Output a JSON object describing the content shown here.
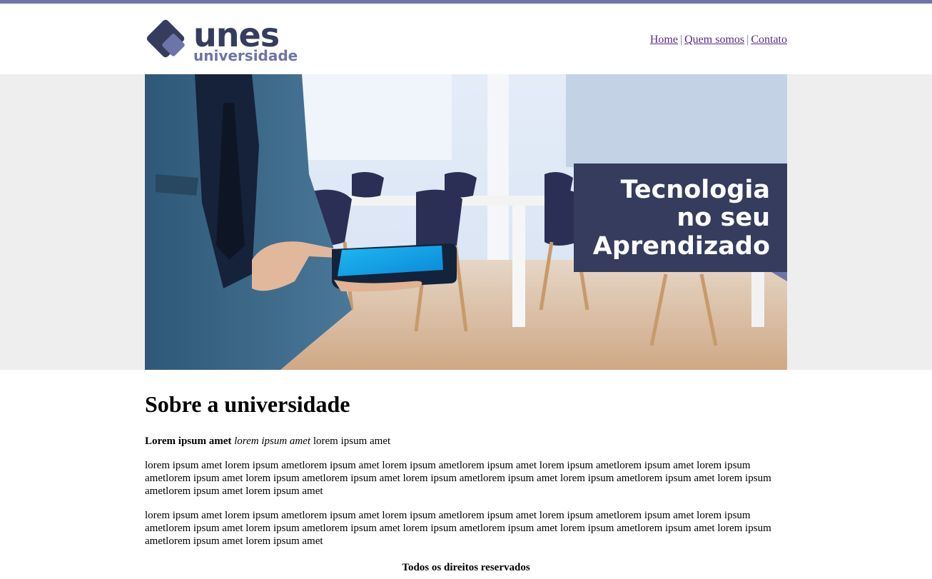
{
  "brand": {
    "name": "unes",
    "tagline": "universidade",
    "colors": {
      "primary": "#363c5e",
      "accent": "#6d75a8"
    }
  },
  "nav": {
    "items": [
      {
        "label": "Home"
      },
      {
        "label": "Quem somos"
      },
      {
        "label": "Contato"
      }
    ],
    "separator": "|"
  },
  "banner": {
    "line1": "Tecnologia",
    "line2": "no seu",
    "line3": "Aprendizado"
  },
  "main": {
    "title": "Sobre a universidade",
    "lead_bold": "Lorem ipsum amet",
    "lead_italic": "lorem ipsum amet",
    "lead_plain": "lorem ipsum amet",
    "paragraph1": "lorem ipsum amet lorem ipsum ametlorem ipsum amet lorem ipsum ametlorem ipsum amet lorem ipsum ametlorem ipsum amet lorem ipsum ametlorem ipsum amet lorem ipsum ametlorem ipsum amet lorem ipsum ametlorem ipsum amet lorem ipsum ametlorem ipsum amet lorem ipsum ametlorem ipsum amet lorem ipsum amet",
    "paragraph2": "lorem ipsum amet lorem ipsum ametlorem ipsum amet lorem ipsum ametlorem ipsum amet lorem ipsum ametlorem ipsum amet lorem ipsum ametlorem ipsum amet lorem ipsum ametlorem ipsum amet lorem ipsum ametlorem ipsum amet lorem ipsum ametlorem ipsum amet lorem ipsum ametlorem ipsum amet lorem ipsum amet"
  },
  "footer": {
    "text": "Todos os direitos reservados"
  }
}
